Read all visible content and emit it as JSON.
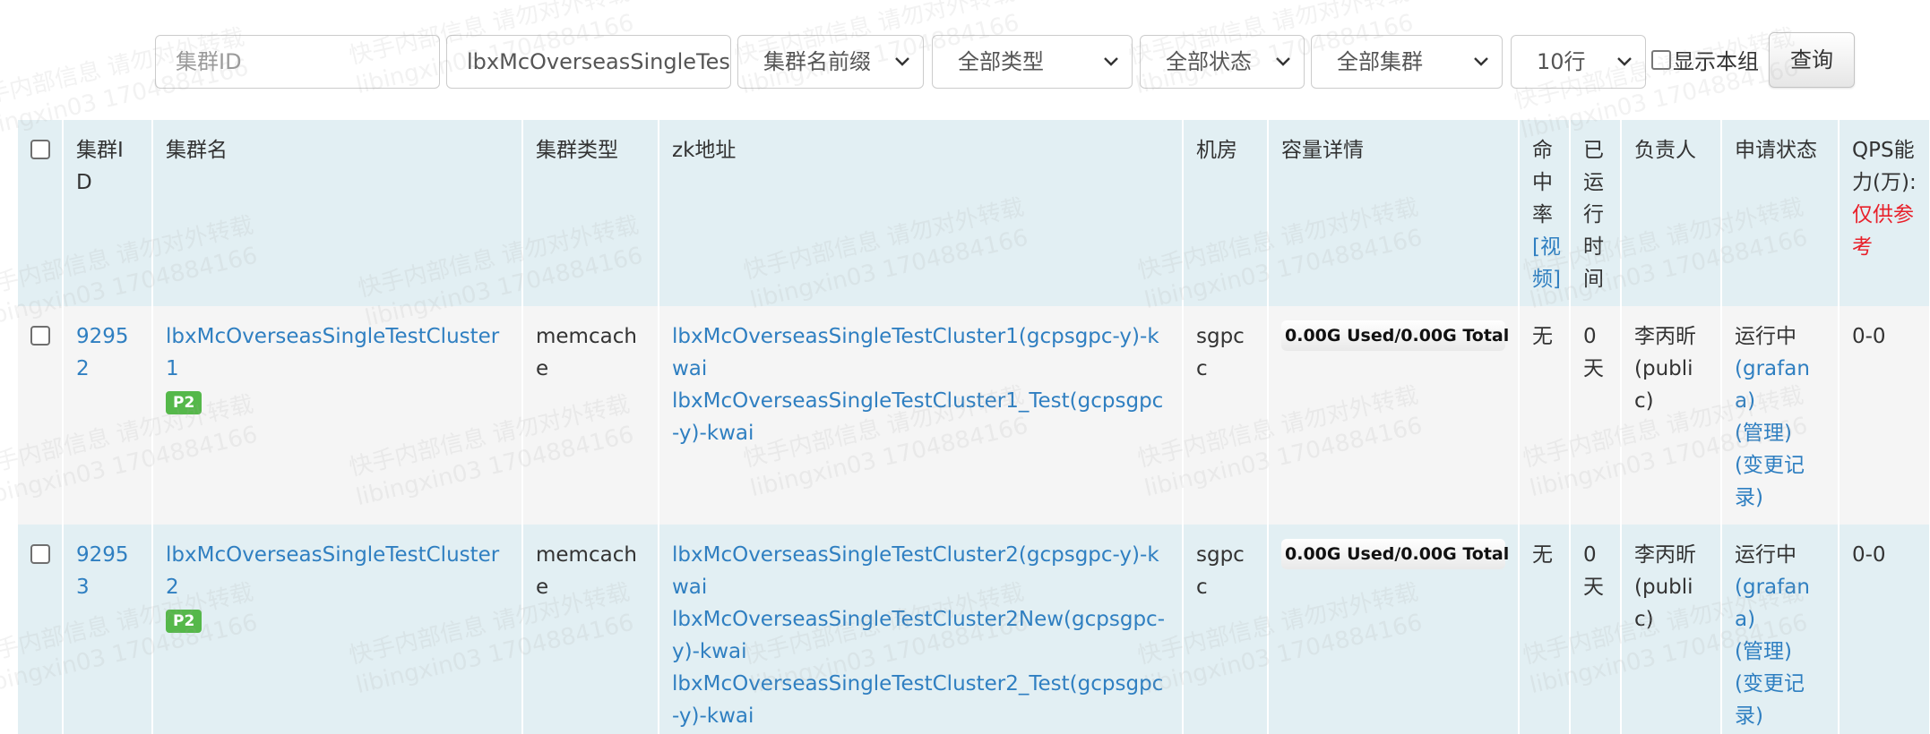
{
  "filters": {
    "cluster_id": {
      "placeholder": "集群ID",
      "value": ""
    },
    "cluster_name": {
      "value": "lbxMcOverseasSingleTes"
    },
    "name_match": {
      "selected": "集群名前缀"
    },
    "type": {
      "selected": "全部类型"
    },
    "status": {
      "selected": "全部状态"
    },
    "cluster_scope": {
      "selected": "全部集群"
    },
    "page_size": {
      "selected": "10行"
    },
    "show_group_label": "显示本组",
    "query_button": "查询"
  },
  "table": {
    "headers": {
      "id": "集群ID",
      "name": "集群名",
      "type": "集群类型",
      "zk": "zk地址",
      "room": "机房",
      "capacity": "容量详情",
      "hit_rate": "命中率",
      "hit_rate_link": "[视频]",
      "uptime": "已运行时间",
      "owner": "负责人",
      "apply_status": "申请状态",
      "qps": "QPS能力(万):",
      "qps_note": "仅供参考"
    },
    "rows": [
      {
        "id": "92952",
        "name": "lbxMcOverseasSingleTestCluster1",
        "priority": "P2",
        "type": "memcache",
        "zk": [
          "lbxMcOverseasSingleTestCluster1(gcpsgpc-y)-kwai",
          "lbxMcOverseasSingleTestCluster1_Test(gcpsgpc-y)-kwai",
          ""
        ],
        "room": "sgpcc",
        "capacity": {
          "used": "0.00G Used",
          "total": "/0.00G Total",
          "used_fraction": 0
        },
        "hit_rate": "无",
        "uptime": "0天",
        "owner": "李丙昕(public)",
        "status": "运行中",
        "links": [
          "(grafana)",
          "(管理)",
          "(变更记录)"
        ],
        "qps": "0-0"
      },
      {
        "id": "92953",
        "name": "lbxMcOverseasSingleTestCluster2",
        "priority": "P2",
        "type": "memcache",
        "zk": [
          "lbxMcOverseasSingleTestCluster2(gcpsgpc-y)-kwai",
          "lbxMcOverseasSingleTestCluster2New(gcpsgpc-y)-kwai",
          "lbxMcOverseasSingleTestCluster2_Test(gcpsgpc-y)-kwai"
        ],
        "room": "sgpcc",
        "capacity": {
          "used": "0.00G Used",
          "total": "/0.00G Total",
          "used_fraction": 0
        },
        "hit_rate": "无",
        "uptime": "0天",
        "owner": "李丙昕(public)",
        "status": "运行中",
        "links": [
          "(grafana)",
          "(管理)",
          "(变更记录)"
        ],
        "qps": "0-0"
      }
    ]
  },
  "watermark": {
    "line1": "快手内部信息 请勿对外转载",
    "line2": "libingxin03 1704884166"
  },
  "colors": {
    "link": "#2f7fc1",
    "badge": "#55b84a",
    "header_bg": "#e2eff3",
    "warning": "#e8202a"
  }
}
